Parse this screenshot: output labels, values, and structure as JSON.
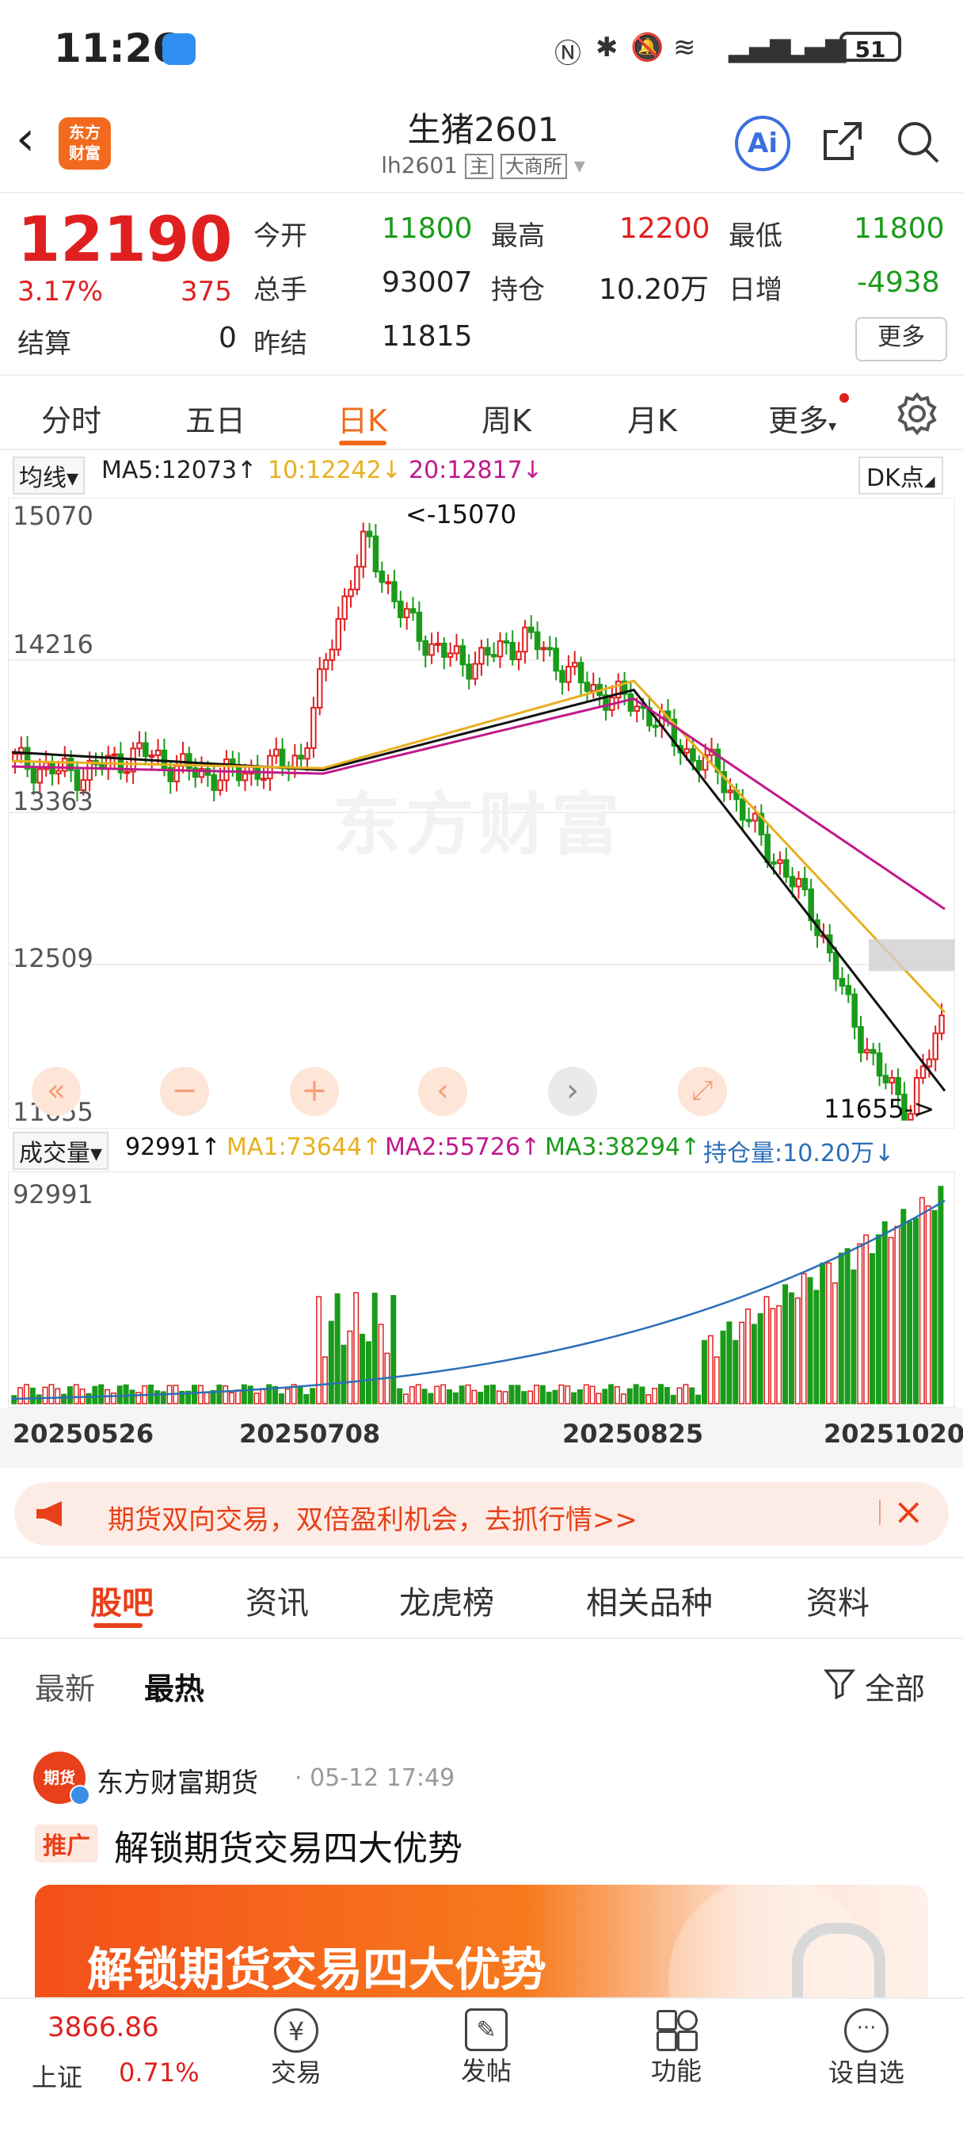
{
  "status": {
    "time": "11:26",
    "battery": "51"
  },
  "header": {
    "back_icon": "back-arrow-icon",
    "logo_text": "东方\n财富",
    "title": "生猪2601",
    "code": "lh2601",
    "badge_main": "主",
    "exchange": "大商所",
    "ai_label": "Ai"
  },
  "quote": {
    "price": "12190",
    "change_pct": "3.17%",
    "change": "375",
    "settle_label": "结算",
    "settle": "0",
    "open_label": "今开",
    "open": "11800",
    "high_label": "最高",
    "high": "12200",
    "low_label": "最低",
    "low": "11800",
    "volume_label": "总手",
    "volume": "93007",
    "oi_label": "持仓",
    "oi": "10.20万",
    "daily_inc_label": "日增",
    "daily_inc": "-4938",
    "prev_settle_label": "昨结",
    "prev_settle": "11815",
    "more_label": "更多"
  },
  "tabs": [
    "分时",
    "五日",
    "日K",
    "周K",
    "月K",
    "更多"
  ],
  "active_tab": "日K",
  "kline": {
    "selector": "均线",
    "ma5": "MA5:12073↑",
    "ma10": "10:12242↓",
    "ma20": "20:12817↓",
    "dk_label": "DK点",
    "y_labels": [
      "15070",
      "14216",
      "13363",
      "12509",
      "11655"
    ],
    "high_marker": "<-15070",
    "low_marker": "11655->",
    "watermark": "东方财富"
  },
  "volume_panel": {
    "selector": "成交量",
    "vol": "92991↑",
    "ma1": "MA1:73644↑",
    "ma2": "MA2:55726↑",
    "ma3": "MA3:38294↑",
    "oi": "持仓量:10.20万↓",
    "y_top": "92991",
    "dates": [
      "20250526",
      "20250708",
      "20250825",
      "20251020"
    ]
  },
  "chart_data": {
    "type": "line",
    "title": "",
    "xlabel": "",
    "ylabel": "",
    "ylim": [
      11655,
      15070
    ],
    "x": [
      "20250526",
      "20250708",
      "20250825",
      "20251020"
    ],
    "series": [
      {
        "name": "MA5",
        "values": [
          13700,
          13600,
          14050,
          11800
        ]
      },
      {
        "name": "10",
        "values": [
          13650,
          13610,
          14100,
          12240
        ]
      },
      {
        "name": "20",
        "values": [
          13620,
          13580,
          14000,
          12820
        ]
      }
    ]
  },
  "banner": {
    "text": "期货双向交易，双倍盈利机会，去抓行情>>"
  },
  "subtabs": [
    "股吧",
    "资讯",
    "龙虎榜",
    "相关品种",
    "资料"
  ],
  "sort": {
    "latest": "最新",
    "hot": "最热",
    "filter": "全部"
  },
  "post": {
    "author": "东方财富期货",
    "time": "· 05-12 17:49",
    "tag": "推广",
    "title": "解锁期货交易四大优势",
    "avatar_text": "期货",
    "ad_text": "解锁期货交易四大优势"
  },
  "bottom_nav": {
    "index_value": "3866.86",
    "index_name": "上证",
    "index_pct": "0.71%",
    "items": [
      "交易",
      "发帖",
      "功能",
      "设自选"
    ]
  },
  "colors": {
    "up": "#e02020",
    "down": "#1a9b1a",
    "accent": "#f06a1a"
  }
}
